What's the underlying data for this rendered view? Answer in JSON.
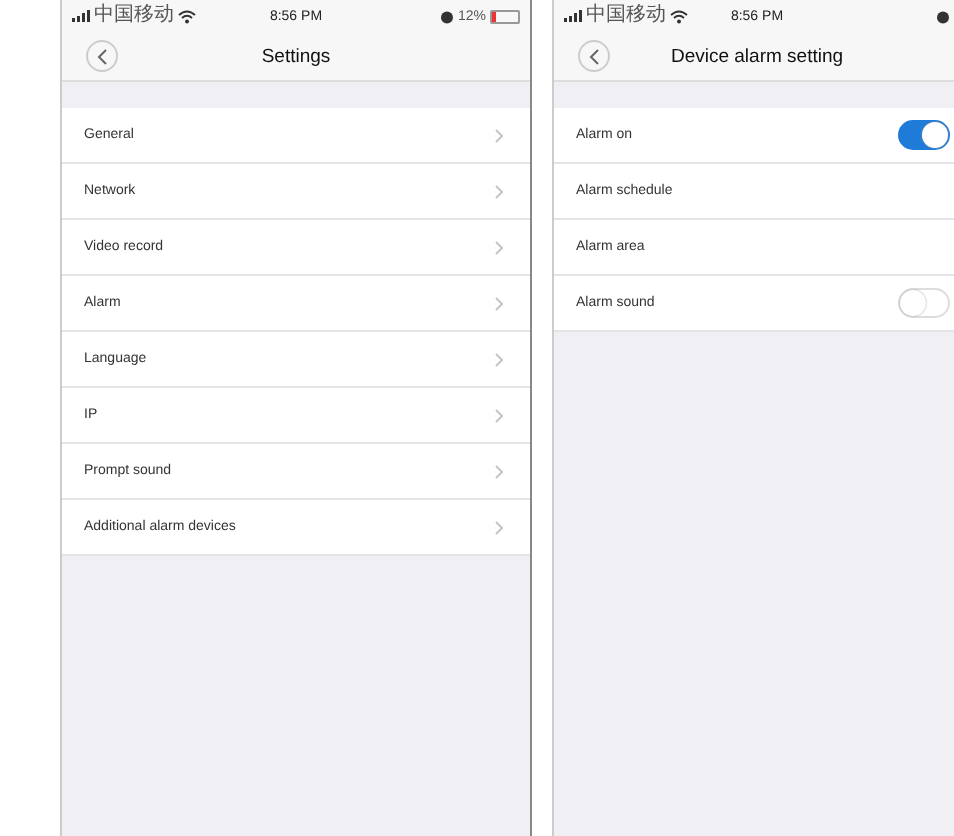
{
  "screens": [
    {
      "status_bar": {
        "carrier": "中国移动",
        "time": "8:56 PM",
        "battery": "12%"
      },
      "title": "Settings",
      "rows": [
        {
          "label": "General",
          "kind": "link"
        },
        {
          "label": "Network",
          "kind": "link"
        },
        {
          "label": "Video record",
          "kind": "link"
        },
        {
          "label": "Alarm",
          "kind": "link"
        },
        {
          "label": "Language",
          "kind": "link"
        },
        {
          "label": "IP",
          "kind": "link"
        },
        {
          "label": "Prompt sound",
          "kind": "link"
        },
        {
          "label": "Additional alarm devices",
          "kind": "link"
        }
      ]
    },
    {
      "status_bar": {
        "carrier": "中国移动",
        "time": "8:56 PM"
      },
      "title": "Device alarm setting",
      "rows": [
        {
          "label": "Alarm on",
          "kind": "toggle",
          "on": true
        },
        {
          "label": "Alarm schedule",
          "kind": "plain"
        },
        {
          "label": "Alarm area",
          "kind": "plain"
        },
        {
          "label": "Alarm sound",
          "kind": "toggle",
          "on": false
        }
      ]
    }
  ]
}
